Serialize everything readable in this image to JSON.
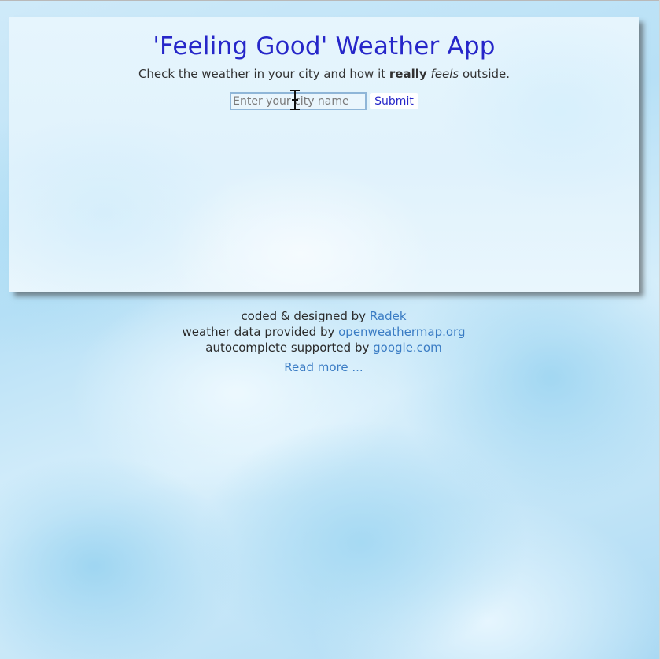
{
  "app": {
    "title": "'Feeling Good' Weather App",
    "subtitle_prefix": "Check the weather in your city and how it ",
    "subtitle_strong": "really",
    "subtitle_italic": "feels",
    "subtitle_suffix": " outside."
  },
  "form": {
    "city_placeholder": "Enter your city name",
    "city_value": "",
    "submit_label": "Submit"
  },
  "footer": {
    "coded_prefix": "coded & designed by ",
    "coded_link": "Radek",
    "data_prefix": "weather data provided by ",
    "data_link": "openweathermap.org",
    "autocomplete_prefix": "autocomplete supported by ",
    "autocomplete_link": "google.com",
    "read_more": "Read more ..."
  },
  "colors": {
    "title": "#2626c9",
    "link": "#3a7cc4",
    "card_bg": "#e3f4fc",
    "page_bg": "#b7e0f6"
  },
  "icons": {
    "cursor": "text-cursor-icon"
  }
}
